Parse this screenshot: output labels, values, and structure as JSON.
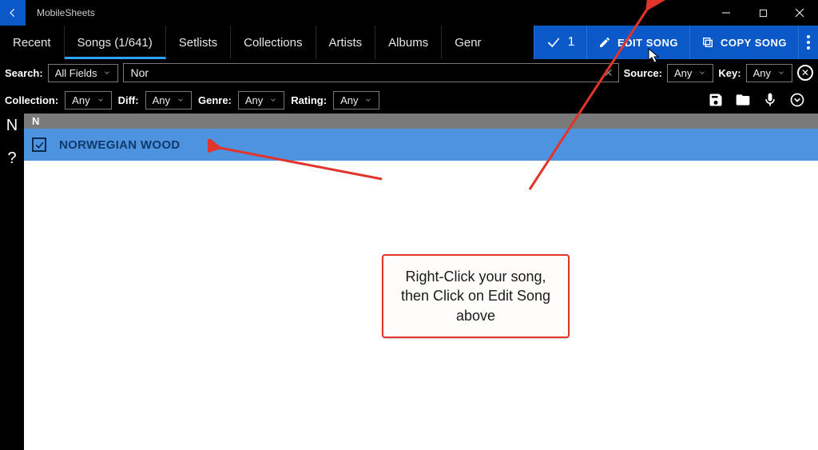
{
  "titlebar": {
    "app_name": "MobileSheets"
  },
  "tabs": {
    "recent": "Recent",
    "songs": "Songs (1/641)",
    "setlists": "Setlists",
    "collections": "Collections",
    "artists": "Artists",
    "albums": "Albums",
    "genres": "Genr"
  },
  "selection": {
    "count": "1",
    "edit": "EDIT SONG",
    "copy": "COPY SONG"
  },
  "filters1": {
    "search_label": "Search:",
    "all_fields": "All Fields",
    "query": "Nor",
    "source_label": "Source:",
    "source_value": "Any",
    "key_label": "Key:",
    "key_value": "Any"
  },
  "filters2": {
    "collection_label": "Collection:",
    "collection_value": "Any",
    "diff_label": "Diff:",
    "diff_value": "Any",
    "genre_label": "Genre:",
    "genre_value": "Any",
    "rating_label": "Rating:",
    "rating_value": "Any"
  },
  "az": {
    "letter": "N",
    "help": "?"
  },
  "list": {
    "group": "N",
    "song1": "NORWEGIAN WOOD"
  },
  "callout": {
    "text": "Right-Click your song, then Click on Edit Song above"
  }
}
